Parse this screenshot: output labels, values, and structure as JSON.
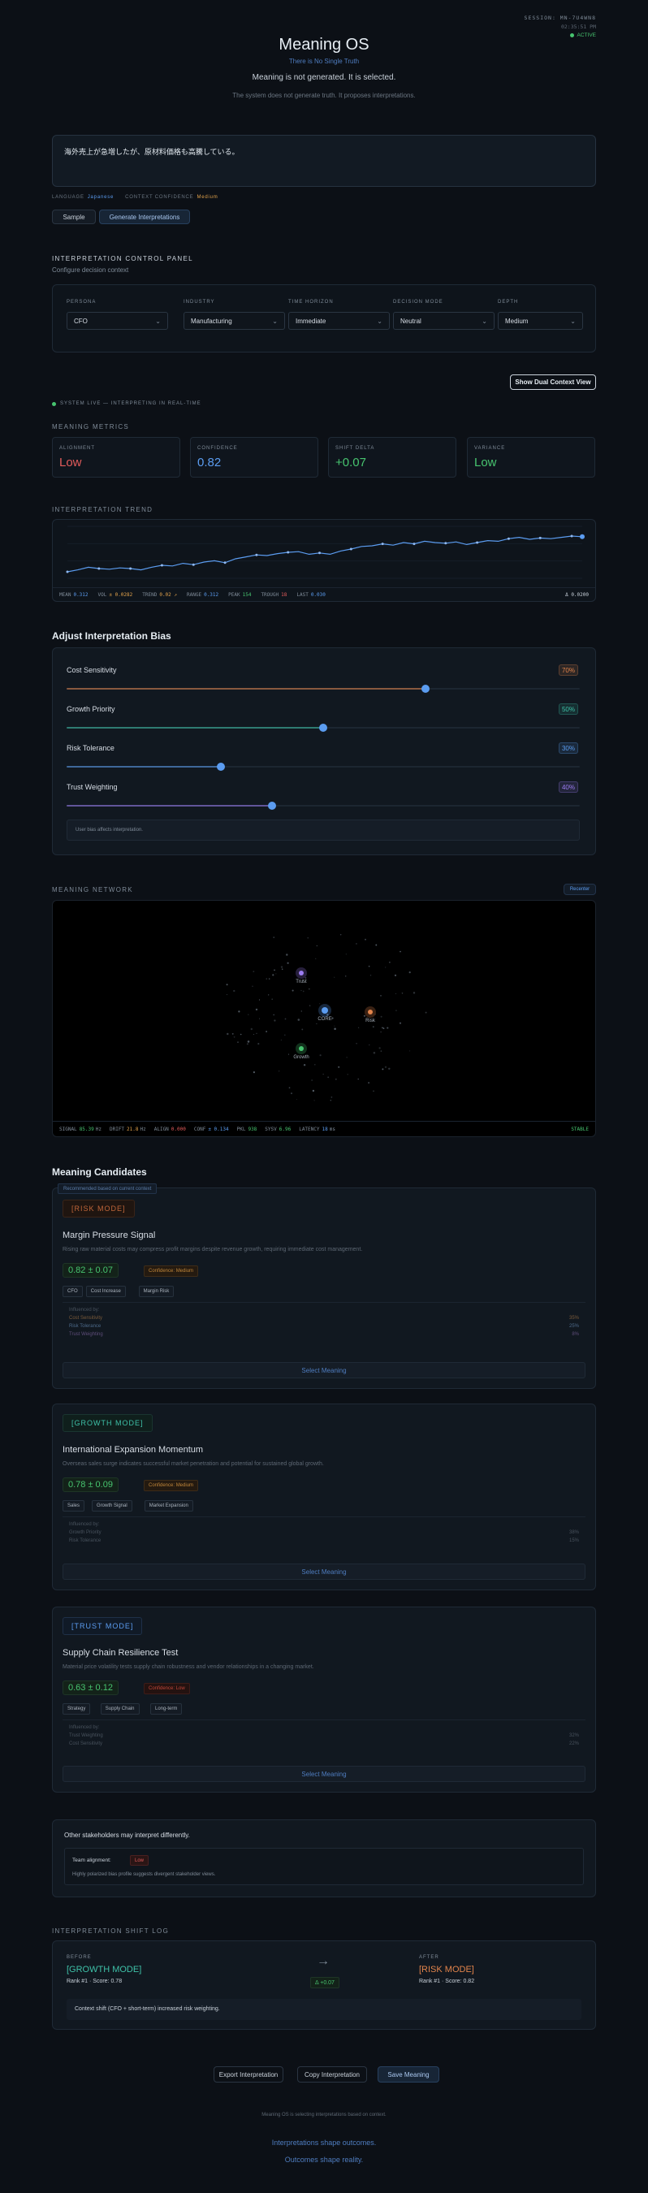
{
  "session": {
    "id": "SESSION: MN-7U4WN8",
    "time": "02:35:51 PM",
    "status": "ACTIVE"
  },
  "hero": {
    "title": "Meaning OS",
    "subtitle": "There is No Single Truth",
    "tagline": "Meaning is not generated. It is selected.",
    "desc": "The system does not generate truth. It proposes interpretations."
  },
  "input": {
    "text": "海外売上が急増したが、原材料価格も高騰している。",
    "language_label": "LANGUAGE",
    "language": "Japanese",
    "ctx_label": "CONTEXT CONFIDENCE",
    "ctx": "Medium",
    "sample_button": "Sample",
    "generate_button": "Generate Interpretations"
  },
  "control": {
    "title": "INTERPRETATION CONTROL PANEL",
    "sub": "Configure decision context",
    "selects": [
      {
        "label": "PERSONA",
        "value": "CFO"
      },
      {
        "label": "INDUSTRY",
        "value": "Manufacturing"
      },
      {
        "label": "TIME HORIZON",
        "value": "Immediate"
      },
      {
        "label": "DECISION MODE",
        "value": "Neutral"
      },
      {
        "label": "DEPTH",
        "value": "Medium"
      }
    ],
    "dual_button": "Show Dual Context View"
  },
  "live": "SYSTEM LIVE — INTERPRETING IN REAL-TIME",
  "metrics": {
    "title": "MEANING METRICS",
    "items": [
      {
        "label": "ALIGNMENT",
        "value": "Low",
        "color": "#e25b5b"
      },
      {
        "label": "CONFIDENCE",
        "value": "0.82",
        "color": "#5b9cf0"
      },
      {
        "label": "SHIFT DELTA",
        "value": "+0.07",
        "color": "#47c46f"
      },
      {
        "label": "VARIANCE",
        "value": "Low",
        "color": "#47c46f"
      }
    ]
  },
  "trend": {
    "title": "INTERPRETATION TREND",
    "stats": [
      {
        "label": "MEAN",
        "value": "0.312",
        "color": "#5b9cf0"
      },
      {
        "label": "VOL",
        "value": "± 0.0282",
        "color": "#e2a24b"
      },
      {
        "label": "TREND",
        "value": "0.02 ↗",
        "color": "#e2a24b"
      },
      {
        "label": "RANGE",
        "value": "0.312",
        "color": "#5b9cf0"
      },
      {
        "label": "PEAK",
        "value": "154",
        "color": "#47c46f"
      },
      {
        "label": "TROUGH",
        "value": "18",
        "color": "#e25b5b"
      },
      {
        "label": "LAST",
        "value": "0.030",
        "color": "#5b9cf0"
      }
    ],
    "delta": "Δ 0.0200"
  },
  "chart_data": {
    "type": "line",
    "series": [
      {
        "values": [
          0.1,
          0.13,
          0.17,
          0.15,
          0.14,
          0.16,
          0.15,
          0.13,
          0.17,
          0.2,
          0.19,
          0.23,
          0.21,
          0.25,
          0.27,
          0.24,
          0.3,
          0.33,
          0.36,
          0.35,
          0.38,
          0.4,
          0.41,
          0.37,
          0.39,
          0.37,
          0.42,
          0.45,
          0.49,
          0.5,
          0.53,
          0.51,
          0.55,
          0.53,
          0.57,
          0.55,
          0.54,
          0.56,
          0.52,
          0.55,
          0.58,
          0.57,
          0.61,
          0.63,
          0.6,
          0.62,
          0.61,
          0.63,
          0.65,
          0.64
        ]
      }
    ],
    "ylim": [
      0,
      0.8
    ]
  },
  "bias": {
    "title": "Adjust Interpretation Bias",
    "items": [
      {
        "label": "Cost Sensitivity",
        "pct": "70%",
        "value": 0.7,
        "color": "#e2844b"
      },
      {
        "label": "Growth Priority",
        "pct": "50%",
        "value": 0.5,
        "color": "#3ec1a8"
      },
      {
        "label": "Risk Tolerance",
        "pct": "30%",
        "value": 0.3,
        "color": "#5b9cf0"
      },
      {
        "label": "Trust Weighting",
        "pct": "40%",
        "value": 0.4,
        "color": "#9b7cf0"
      }
    ],
    "note": "User bias affects interpretation."
  },
  "network": {
    "title": "MEANING NETWORK",
    "button": "Recenter",
    "nodes": {
      "trust": "Trust",
      "core": "CORE",
      "risk": "Risk",
      "growth": "Growth"
    },
    "stats": [
      {
        "label": "SIGNAL",
        "value": "85.39",
        "unit": "Hz",
        "color": "#47c46f"
      },
      {
        "label": "DRIFT",
        "value": "21.8",
        "unit": "Hz",
        "color": "#e2a24b"
      },
      {
        "label": "ALIGN",
        "value": "0.000",
        "unit": "",
        "color": "#e25b5b"
      },
      {
        "label": "CONF",
        "value": "± 0.134",
        "unit": "",
        "color": "#5b9cf0"
      },
      {
        "label": "PKL",
        "value": "938",
        "unit": "",
        "color": "#47c46f"
      },
      {
        "label": "SYSV",
        "value": "6.96",
        "unit": "",
        "color": "#47c46f"
      },
      {
        "label": "LATENCY",
        "value": "18",
        "unit": "ms",
        "color": "#5b9cf0"
      }
    ],
    "state": "STABLE"
  },
  "candidates": {
    "title": "Meaning Candidates",
    "recommend": "Recommended based on current context",
    "items": [
      {
        "tag": "[RISK MODE]",
        "title": "Margin Pressure Signal",
        "desc": "Rising raw material costs may compress profit margins despite revenue growth, requiring immediate cost management.",
        "score": "0.82 ± 0.07",
        "conf": "Confidence: Medium",
        "chips": [
          "CFO",
          "Cost Increase",
          "Margin Risk"
        ],
        "inf_title": "Influenced by:",
        "inf": [
          {
            "k": "Cost Sensitivity",
            "v": "35%"
          },
          {
            "k": "Risk Tolerance",
            "v": "25%"
          },
          {
            "k": "Trust Weighting",
            "v": "8%"
          }
        ],
        "select": "Select Meaning"
      },
      {
        "tag": "[GROWTH MODE]",
        "title": "International Expansion Momentum",
        "desc": "Overseas sales surge indicates successful market penetration and potential for sustained global growth.",
        "score": "0.78 ± 0.09",
        "conf": "Confidence: Medium",
        "chips": [
          "Sales",
          "Growth Signal",
          "Market Expansion"
        ],
        "inf_title": "Influenced by:",
        "inf": [
          {
            "k": "Growth Priority",
            "v": "38%"
          },
          {
            "k": "Risk Tolerance",
            "v": "15%"
          }
        ],
        "select": "Select Meaning"
      },
      {
        "tag": "[TRUST MODE]",
        "title": "Supply Chain Resilience Test",
        "desc": "Material price volatility tests supply chain robustness and vendor relationships in a changing market.",
        "score": "0.63 ± 0.12",
        "conf": "Confidence: Low",
        "chips": [
          "Strategy",
          "Supply Chain",
          "Long-term"
        ],
        "inf_title": "Influenced by:",
        "inf": [
          {
            "k": "Trust Weighting",
            "v": "32%"
          },
          {
            "k": "Cost Sensitivity",
            "v": "22%"
          }
        ],
        "select": "Select Meaning"
      }
    ]
  },
  "stakeholders": {
    "title": "Other stakeholders may interpret differently.",
    "label": "Team alignment:",
    "badge": "Low",
    "desc": "Highly polarized bias profile suggests divergent stakeholder views."
  },
  "shift": {
    "title": "INTERPRETATION SHIFT LOG",
    "before_label": "BEFORE",
    "before_mode": "[GROWTH MODE]",
    "before_meta": "Rank #1 · Score: 0.78",
    "after_label": "AFTER",
    "after_mode": "[RISK MODE]",
    "after_meta": "Rank #1 · Score: 0.82",
    "delta": "Δ +0.07",
    "desc": "Context shift (CFO + short-term) increased risk weighting."
  },
  "actions": {
    "export": "Export Interpretation",
    "copy": "Copy Interpretation",
    "save": "Save Meaning"
  },
  "footer": {
    "status": "Meaning OS is selecting interpretations based on context.",
    "line1": "Interpretations shape outcomes.",
    "line2": "Outcomes shape reality."
  }
}
